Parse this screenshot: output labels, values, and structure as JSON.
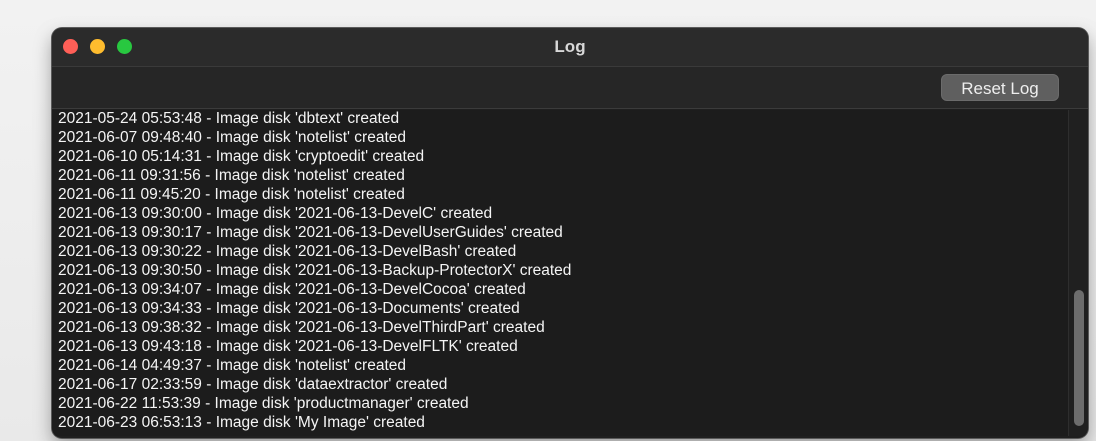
{
  "window": {
    "title": "Log",
    "traffic_lights": {
      "close": "#ff5f57",
      "minimize": "#febc2e",
      "zoom": "#28c840"
    }
  },
  "toolbar": {
    "reset_label": "Reset Log"
  },
  "log": {
    "lines": [
      "2021-05-24 05:53:48 - Image disk 'dbtext' created",
      "2021-06-07 09:48:40 - Image disk 'notelist' created",
      "2021-06-10 05:14:31 - Image disk 'cryptoedit' created",
      "2021-06-11 09:31:56 - Image disk 'notelist' created",
      "2021-06-11 09:45:20 - Image disk 'notelist' created",
      "2021-06-13 09:30:00 - Image disk '2021-06-13-DevelC' created",
      "2021-06-13 09:30:17 - Image disk '2021-06-13-DevelUserGuides' created",
      "2021-06-13 09:30:22 - Image disk '2021-06-13-DevelBash' created",
      "2021-06-13 09:30:50 - Image disk '2021-06-13-Backup-ProtectorX' created",
      "2021-06-13 09:34:07 - Image disk '2021-06-13-DevelCocoa' created",
      "2021-06-13 09:34:33 - Image disk '2021-06-13-Documents' created",
      "2021-06-13 09:38:32 - Image disk '2021-06-13-DevelThirdPart' created",
      "2021-06-13 09:43:18 - Image disk '2021-06-13-DevelFLTK' created",
      "2021-06-14 04:49:37 - Image disk 'notelist' created",
      "2021-06-17 02:33:59 - Image disk 'dataextractor' created",
      "2021-06-22 11:53:39 - Image disk 'productmanager' created",
      "2021-06-23 06:53:13 - Image disk 'My Image' created"
    ]
  }
}
